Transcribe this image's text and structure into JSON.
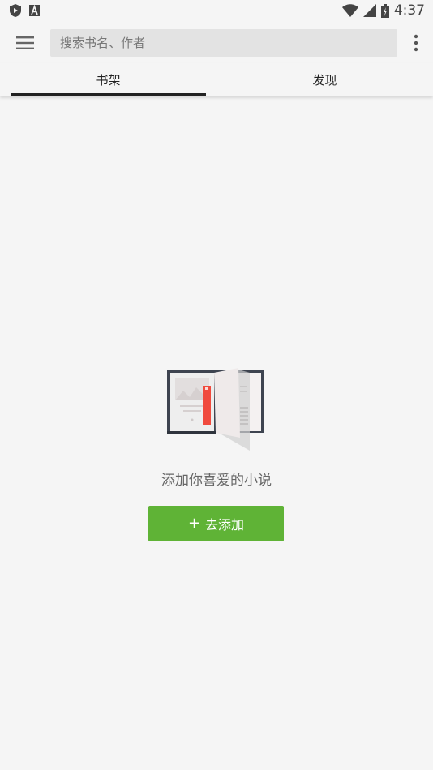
{
  "status_bar": {
    "time": "4:37",
    "icons": [
      "shield-icon",
      "app-a-icon",
      "wifi-icon",
      "signal-icon",
      "battery-icon"
    ]
  },
  "toolbar": {
    "search_placeholder": "搜索书名、作者",
    "menu_icon": "hamburger-menu-icon",
    "more_icon": "more-vert-icon"
  },
  "tabs": [
    {
      "label": "书架",
      "selected": true
    },
    {
      "label": "发现",
      "selected": false
    }
  ],
  "empty_state": {
    "message": "添加你喜爱的小说",
    "button_label": "去添加",
    "button_icon": "plus-icon"
  },
  "colors": {
    "background": "#f5f5f5",
    "accent_green": "#5fb336",
    "bookmark_red": "#f04a3e",
    "search_bg": "#e3e3e3"
  }
}
